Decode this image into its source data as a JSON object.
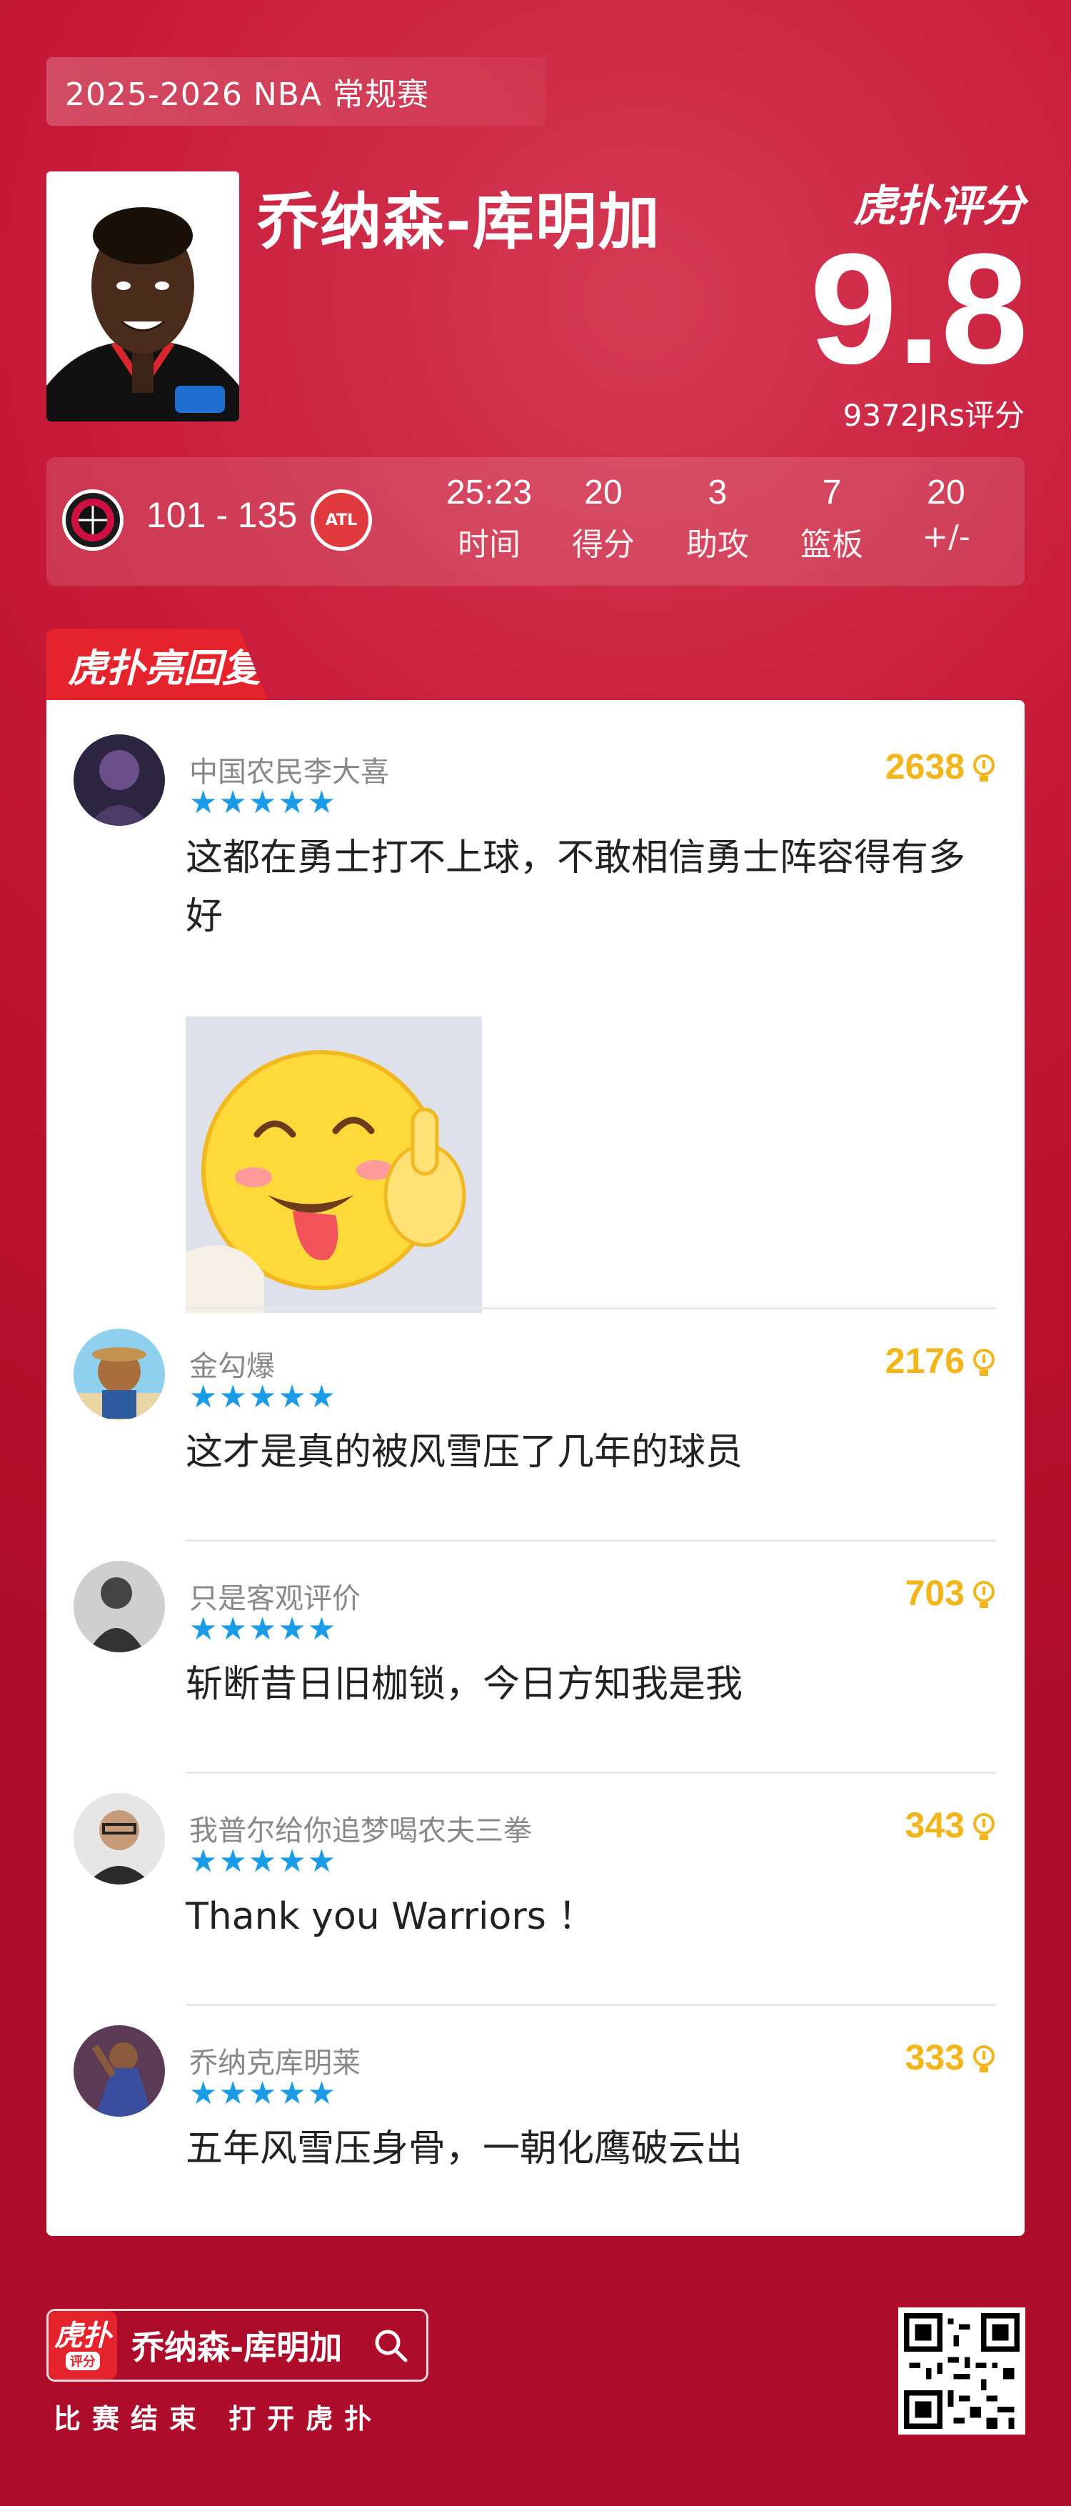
{
  "header": {
    "season": "2025-2026 NBA 常规赛",
    "player_name": "乔纳森-库明加",
    "rating_logo": "虎扑评分",
    "rating_score": "9.8",
    "rating_count": "9372JRs评分"
  },
  "game": {
    "score": "101 - 135",
    "away_logo_text": "ATL",
    "stats": [
      {
        "value": "25:23",
        "label": "时间"
      },
      {
        "value": "20",
        "label": "得分"
      },
      {
        "value": "3",
        "label": "助攻"
      },
      {
        "value": "7",
        "label": "篮板"
      },
      {
        "value": "20",
        "label": "+/-"
      }
    ]
  },
  "hot_replies": {
    "tab_label": "虎扑亮回复",
    "comments": [
      {
        "user": "中国农民李大喜",
        "stars": "★★★★★",
        "likes": "2638",
        "text": "这都在勇士打不上球，不敢相信勇士阵容得有多好"
      },
      {
        "user": "金勾爆",
        "stars": "★★★★★",
        "likes": "2176",
        "text": "这才是真的被风雪压了几年的球员"
      },
      {
        "user": "只是客观评价",
        "stars": "★★★★★",
        "likes": "703",
        "text": "斩断昔日旧枷锁，今日方知我是我"
      },
      {
        "user": "我普尔给你追梦喝农夫三拳",
        "stars": "★★★★★",
        "likes": "343",
        "text": "Thank you Warriors ！"
      },
      {
        "user": "乔纳克库明莱",
        "stars": "★★★★★",
        "likes": "333",
        "text": "五年风雪压身骨，一朝化鹰破云出"
      }
    ]
  },
  "footer": {
    "app_icon_top": "虎扑",
    "app_icon_bottom": "评分",
    "search_text": "乔纳森-库明加",
    "cta": "比赛结束 打开虎扑"
  },
  "colors": {
    "background": "#c81d3b",
    "accent_red": "#e5232d",
    "likes_gold": "#f3b51c",
    "star_blue": "#1a9be8"
  }
}
